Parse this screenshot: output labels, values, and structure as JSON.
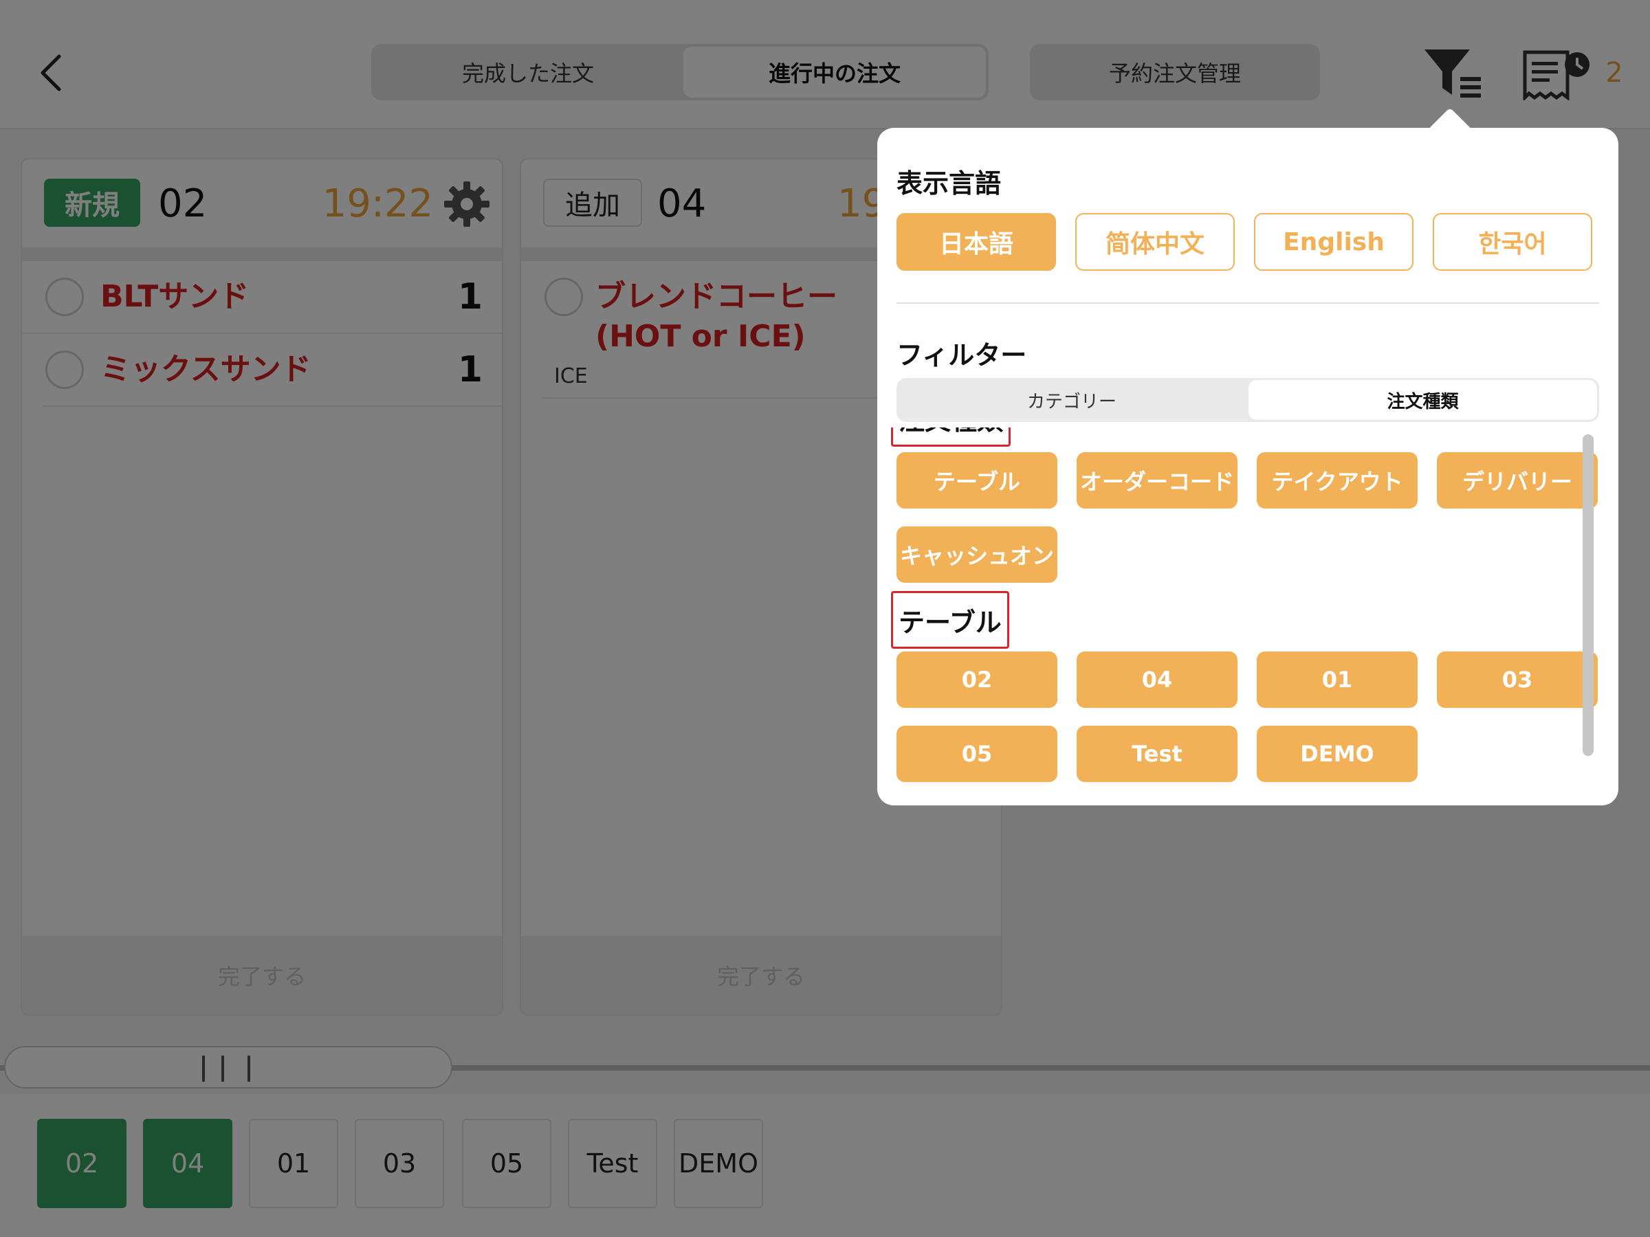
{
  "header": {
    "tabs": [
      {
        "label": "完成した注文",
        "active": false
      },
      {
        "label": "進行中の注文",
        "active": true
      }
    ],
    "reserve_label": "予約注文管理",
    "history_count": "2",
    "accent_color": "#e9a23b"
  },
  "orders": [
    {
      "badge": "新規",
      "badge_color": "#34a462",
      "table": "02",
      "time": "19:22",
      "items": [
        {
          "name": "BLTサンド",
          "qty": "1"
        },
        {
          "name": "ミックスサンド",
          "qty": "1"
        }
      ],
      "complete_label": "完了する"
    },
    {
      "badge": "追加",
      "table": "04",
      "time": "19",
      "items": [
        {
          "name_line1": "ブレンドコーヒー",
          "name_line2": "(HOT or ICE)",
          "option": "ICE"
        }
      ],
      "complete_label": "完了する"
    }
  ],
  "table_bar": [
    {
      "label": "02",
      "active": true
    },
    {
      "label": "04",
      "active": true
    },
    {
      "label": "01",
      "active": false
    },
    {
      "label": "03",
      "active": false
    },
    {
      "label": "05",
      "active": false
    },
    {
      "label": "Test",
      "active": false
    },
    {
      "label": "DEMO",
      "active": false
    }
  ],
  "popover": {
    "language_heading": "表示言語",
    "languages": [
      {
        "label": "日本語",
        "active": true
      },
      {
        "label": "简体中文",
        "active": false
      },
      {
        "label": "English",
        "active": false
      },
      {
        "label": "한국어",
        "active": false
      }
    ],
    "filter_heading": "フィルター",
    "filter_tabs": [
      {
        "label": "カテゴリー",
        "active": false
      },
      {
        "label": "注文種類",
        "active": true
      }
    ],
    "order_type_title": "注文種類",
    "order_types": [
      "テーブル",
      "オーダーコード",
      "テイクアウト",
      "デリバリー",
      "キャッシュオン"
    ],
    "table_title": "テーブル",
    "tables": [
      "02",
      "04",
      "01",
      "03",
      "05",
      "Test",
      "DEMO"
    ],
    "chip_color": "#f2b157",
    "highlight_color": "#d7262b"
  }
}
